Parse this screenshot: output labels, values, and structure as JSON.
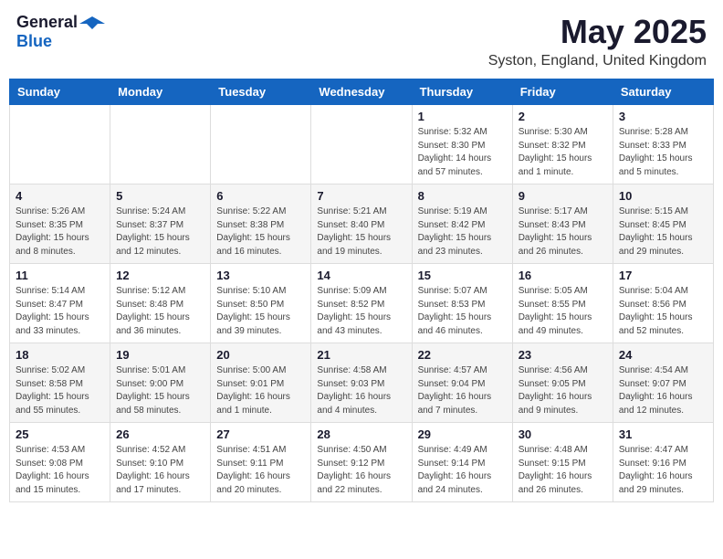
{
  "header": {
    "logo_general": "General",
    "logo_blue": "Blue",
    "title": "May 2025",
    "subtitle": "Syston, England, United Kingdom"
  },
  "weekdays": [
    "Sunday",
    "Monday",
    "Tuesday",
    "Wednesday",
    "Thursday",
    "Friday",
    "Saturday"
  ],
  "weeks": [
    [
      {
        "day": "",
        "info": ""
      },
      {
        "day": "",
        "info": ""
      },
      {
        "day": "",
        "info": ""
      },
      {
        "day": "",
        "info": ""
      },
      {
        "day": "1",
        "info": "Sunrise: 5:32 AM\nSunset: 8:30 PM\nDaylight: 14 hours and 57 minutes."
      },
      {
        "day": "2",
        "info": "Sunrise: 5:30 AM\nSunset: 8:32 PM\nDaylight: 15 hours and 1 minute."
      },
      {
        "day": "3",
        "info": "Sunrise: 5:28 AM\nSunset: 8:33 PM\nDaylight: 15 hours and 5 minutes."
      }
    ],
    [
      {
        "day": "4",
        "info": "Sunrise: 5:26 AM\nSunset: 8:35 PM\nDaylight: 15 hours and 8 minutes."
      },
      {
        "day": "5",
        "info": "Sunrise: 5:24 AM\nSunset: 8:37 PM\nDaylight: 15 hours and 12 minutes."
      },
      {
        "day": "6",
        "info": "Sunrise: 5:22 AM\nSunset: 8:38 PM\nDaylight: 15 hours and 16 minutes."
      },
      {
        "day": "7",
        "info": "Sunrise: 5:21 AM\nSunset: 8:40 PM\nDaylight: 15 hours and 19 minutes."
      },
      {
        "day": "8",
        "info": "Sunrise: 5:19 AM\nSunset: 8:42 PM\nDaylight: 15 hours and 23 minutes."
      },
      {
        "day": "9",
        "info": "Sunrise: 5:17 AM\nSunset: 8:43 PM\nDaylight: 15 hours and 26 minutes."
      },
      {
        "day": "10",
        "info": "Sunrise: 5:15 AM\nSunset: 8:45 PM\nDaylight: 15 hours and 29 minutes."
      }
    ],
    [
      {
        "day": "11",
        "info": "Sunrise: 5:14 AM\nSunset: 8:47 PM\nDaylight: 15 hours and 33 minutes."
      },
      {
        "day": "12",
        "info": "Sunrise: 5:12 AM\nSunset: 8:48 PM\nDaylight: 15 hours and 36 minutes."
      },
      {
        "day": "13",
        "info": "Sunrise: 5:10 AM\nSunset: 8:50 PM\nDaylight: 15 hours and 39 minutes."
      },
      {
        "day": "14",
        "info": "Sunrise: 5:09 AM\nSunset: 8:52 PM\nDaylight: 15 hours and 43 minutes."
      },
      {
        "day": "15",
        "info": "Sunrise: 5:07 AM\nSunset: 8:53 PM\nDaylight: 15 hours and 46 minutes."
      },
      {
        "day": "16",
        "info": "Sunrise: 5:05 AM\nSunset: 8:55 PM\nDaylight: 15 hours and 49 minutes."
      },
      {
        "day": "17",
        "info": "Sunrise: 5:04 AM\nSunset: 8:56 PM\nDaylight: 15 hours and 52 minutes."
      }
    ],
    [
      {
        "day": "18",
        "info": "Sunrise: 5:02 AM\nSunset: 8:58 PM\nDaylight: 15 hours and 55 minutes."
      },
      {
        "day": "19",
        "info": "Sunrise: 5:01 AM\nSunset: 9:00 PM\nDaylight: 15 hours and 58 minutes."
      },
      {
        "day": "20",
        "info": "Sunrise: 5:00 AM\nSunset: 9:01 PM\nDaylight: 16 hours and 1 minute."
      },
      {
        "day": "21",
        "info": "Sunrise: 4:58 AM\nSunset: 9:03 PM\nDaylight: 16 hours and 4 minutes."
      },
      {
        "day": "22",
        "info": "Sunrise: 4:57 AM\nSunset: 9:04 PM\nDaylight: 16 hours and 7 minutes."
      },
      {
        "day": "23",
        "info": "Sunrise: 4:56 AM\nSunset: 9:05 PM\nDaylight: 16 hours and 9 minutes."
      },
      {
        "day": "24",
        "info": "Sunrise: 4:54 AM\nSunset: 9:07 PM\nDaylight: 16 hours and 12 minutes."
      }
    ],
    [
      {
        "day": "25",
        "info": "Sunrise: 4:53 AM\nSunset: 9:08 PM\nDaylight: 16 hours and 15 minutes."
      },
      {
        "day": "26",
        "info": "Sunrise: 4:52 AM\nSunset: 9:10 PM\nDaylight: 16 hours and 17 minutes."
      },
      {
        "day": "27",
        "info": "Sunrise: 4:51 AM\nSunset: 9:11 PM\nDaylight: 16 hours and 20 minutes."
      },
      {
        "day": "28",
        "info": "Sunrise: 4:50 AM\nSunset: 9:12 PM\nDaylight: 16 hours and 22 minutes."
      },
      {
        "day": "29",
        "info": "Sunrise: 4:49 AM\nSunset: 9:14 PM\nDaylight: 16 hours and 24 minutes."
      },
      {
        "day": "30",
        "info": "Sunrise: 4:48 AM\nSunset: 9:15 PM\nDaylight: 16 hours and 26 minutes."
      },
      {
        "day": "31",
        "info": "Sunrise: 4:47 AM\nSunset: 9:16 PM\nDaylight: 16 hours and 29 minutes."
      }
    ]
  ]
}
